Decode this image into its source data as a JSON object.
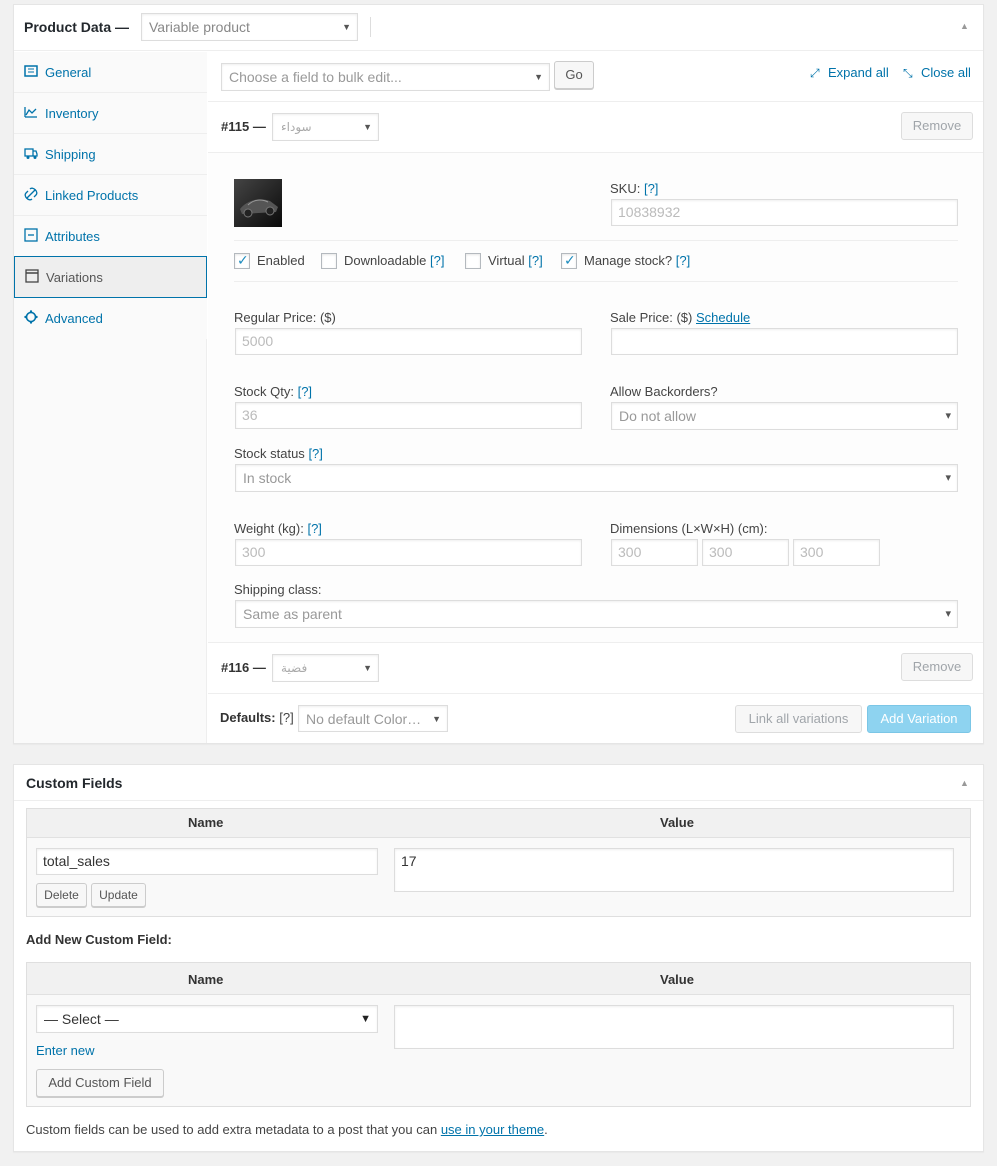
{
  "product_data": {
    "title": "Product Data —",
    "type_select": "Variable product",
    "tabs": [
      {
        "label": "General",
        "icon": "general-icon"
      },
      {
        "label": "Inventory",
        "icon": "inventory-icon"
      },
      {
        "label": "Shipping",
        "icon": "shipping-icon"
      },
      {
        "label": "Linked Products",
        "icon": "link-icon"
      },
      {
        "label": "Attributes",
        "icon": "attributes-icon"
      },
      {
        "label": "Variations",
        "icon": "variations-icon"
      },
      {
        "label": "Advanced",
        "icon": "gear-icon"
      }
    ],
    "active_tab": "Variations",
    "bulk_edit_placeholder": "Choose a field to bulk edit...",
    "go_label": "Go",
    "expand_all": "Expand all",
    "close_all": "Close all",
    "variations": [
      {
        "id": "#115 —",
        "attr_value": "سوداء",
        "remove": "Remove",
        "sku_label": "SKU:",
        "sku_help": "[?]",
        "sku": "10838932",
        "enabled": {
          "label": "Enabled",
          "checked": true
        },
        "downloadable": {
          "label": "Downloadable",
          "help": "[?]",
          "checked": false
        },
        "virtual": {
          "label": "Virtual",
          "help": "[?]",
          "checked": false
        },
        "manage_stock": {
          "label": "Manage stock?",
          "help": "[?]",
          "checked": true
        },
        "regular_price_label": "Regular Price: ($)",
        "regular_price": "5000",
        "sale_price_label": "Sale Price: ($)",
        "schedule_label": "Schedule",
        "sale_price": "",
        "stock_qty_label": "Stock Qty:",
        "stock_qty_help": "[?]",
        "stock_qty": "36",
        "backorders_label": "Allow Backorders?",
        "backorders": "Do not allow",
        "stock_status_label": "Stock status",
        "stock_status_help": "[?]",
        "stock_status": "In stock",
        "weight_label": "Weight (kg):",
        "weight_help": "[?]",
        "weight": "300",
        "dimensions_label": "Dimensions (L×W×H) (cm):",
        "dimensions": [
          "300",
          "300",
          "300"
        ],
        "shipping_class_label": "Shipping class:",
        "shipping_class": "Same as parent"
      },
      {
        "id": "#116 —",
        "attr_value": "فضية",
        "remove": "Remove"
      }
    ],
    "defaults_label": "Defaults:",
    "defaults_help": "[?]",
    "defaults_select": "No default Color…",
    "link_all": "Link all variations",
    "add_variation": "Add Variation"
  },
  "custom_fields": {
    "title": "Custom Fields",
    "col_name": "Name",
    "col_value": "Value",
    "existing": {
      "name": "total_sales",
      "value": "17"
    },
    "delete": "Delete",
    "update": "Update",
    "add_new_title": "Add New Custom Field:",
    "select_placeholder": "— Select —",
    "enter_new": "Enter new",
    "add_button": "Add Custom Field",
    "footer_text": "Custom fields can be used to add extra metadata to a post that you can",
    "footer_link": "use in your theme",
    "footer_end": "."
  }
}
